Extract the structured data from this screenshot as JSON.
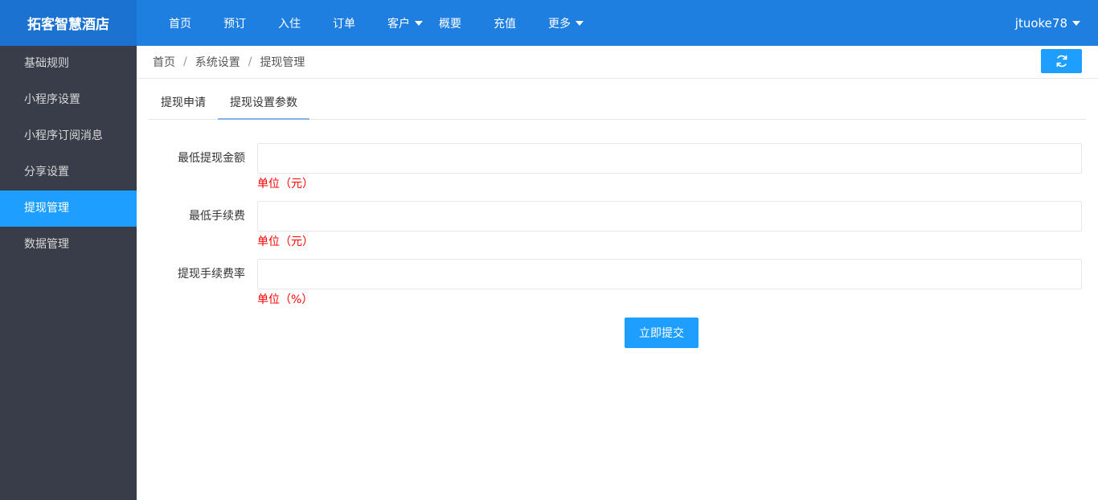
{
  "app": {
    "logo_text": "拓客智慧酒店"
  },
  "topnav": {
    "items": [
      {
        "label": "首页"
      },
      {
        "label": "预订"
      },
      {
        "label": "入住"
      },
      {
        "label": "订单"
      },
      {
        "label": "客户",
        "has_dropdown": true
      },
      {
        "label": "概要"
      },
      {
        "label": "充值"
      },
      {
        "label": "更多",
        "has_dropdown": true
      }
    ],
    "user": {
      "name": "jtuoke78"
    }
  },
  "sidebar": {
    "items": [
      {
        "label": "基础规则"
      },
      {
        "label": "小程序设置"
      },
      {
        "label": "小程序订阅消息"
      },
      {
        "label": "分享设置"
      },
      {
        "label": "提现管理",
        "active": true
      },
      {
        "label": "数据管理"
      }
    ]
  },
  "breadcrumb": {
    "items": [
      "首页",
      "系统设置",
      "提现管理"
    ],
    "separator": "/"
  },
  "tabs": {
    "items": [
      {
        "label": "提现申请"
      },
      {
        "label": "提现设置参数",
        "active": true
      }
    ]
  },
  "form": {
    "fields": [
      {
        "label": "最低提现金额",
        "value": "",
        "placeholder": "",
        "hint": "单位（元）"
      },
      {
        "label": "最低手续费",
        "value": "",
        "placeholder": "",
        "hint": "单位（元）"
      },
      {
        "label": "提现手续费率",
        "value": "",
        "placeholder": "",
        "hint": "单位（%）"
      }
    ],
    "submit_label": "立即提交"
  },
  "colors": {
    "topbar": "#1E7FE0",
    "sidebar": "#393D49",
    "accent": "#1E9FFF",
    "hint": "#FF0000"
  },
  "icons": {
    "refresh": "refresh-icon",
    "caret": "caret-down-icon"
  }
}
